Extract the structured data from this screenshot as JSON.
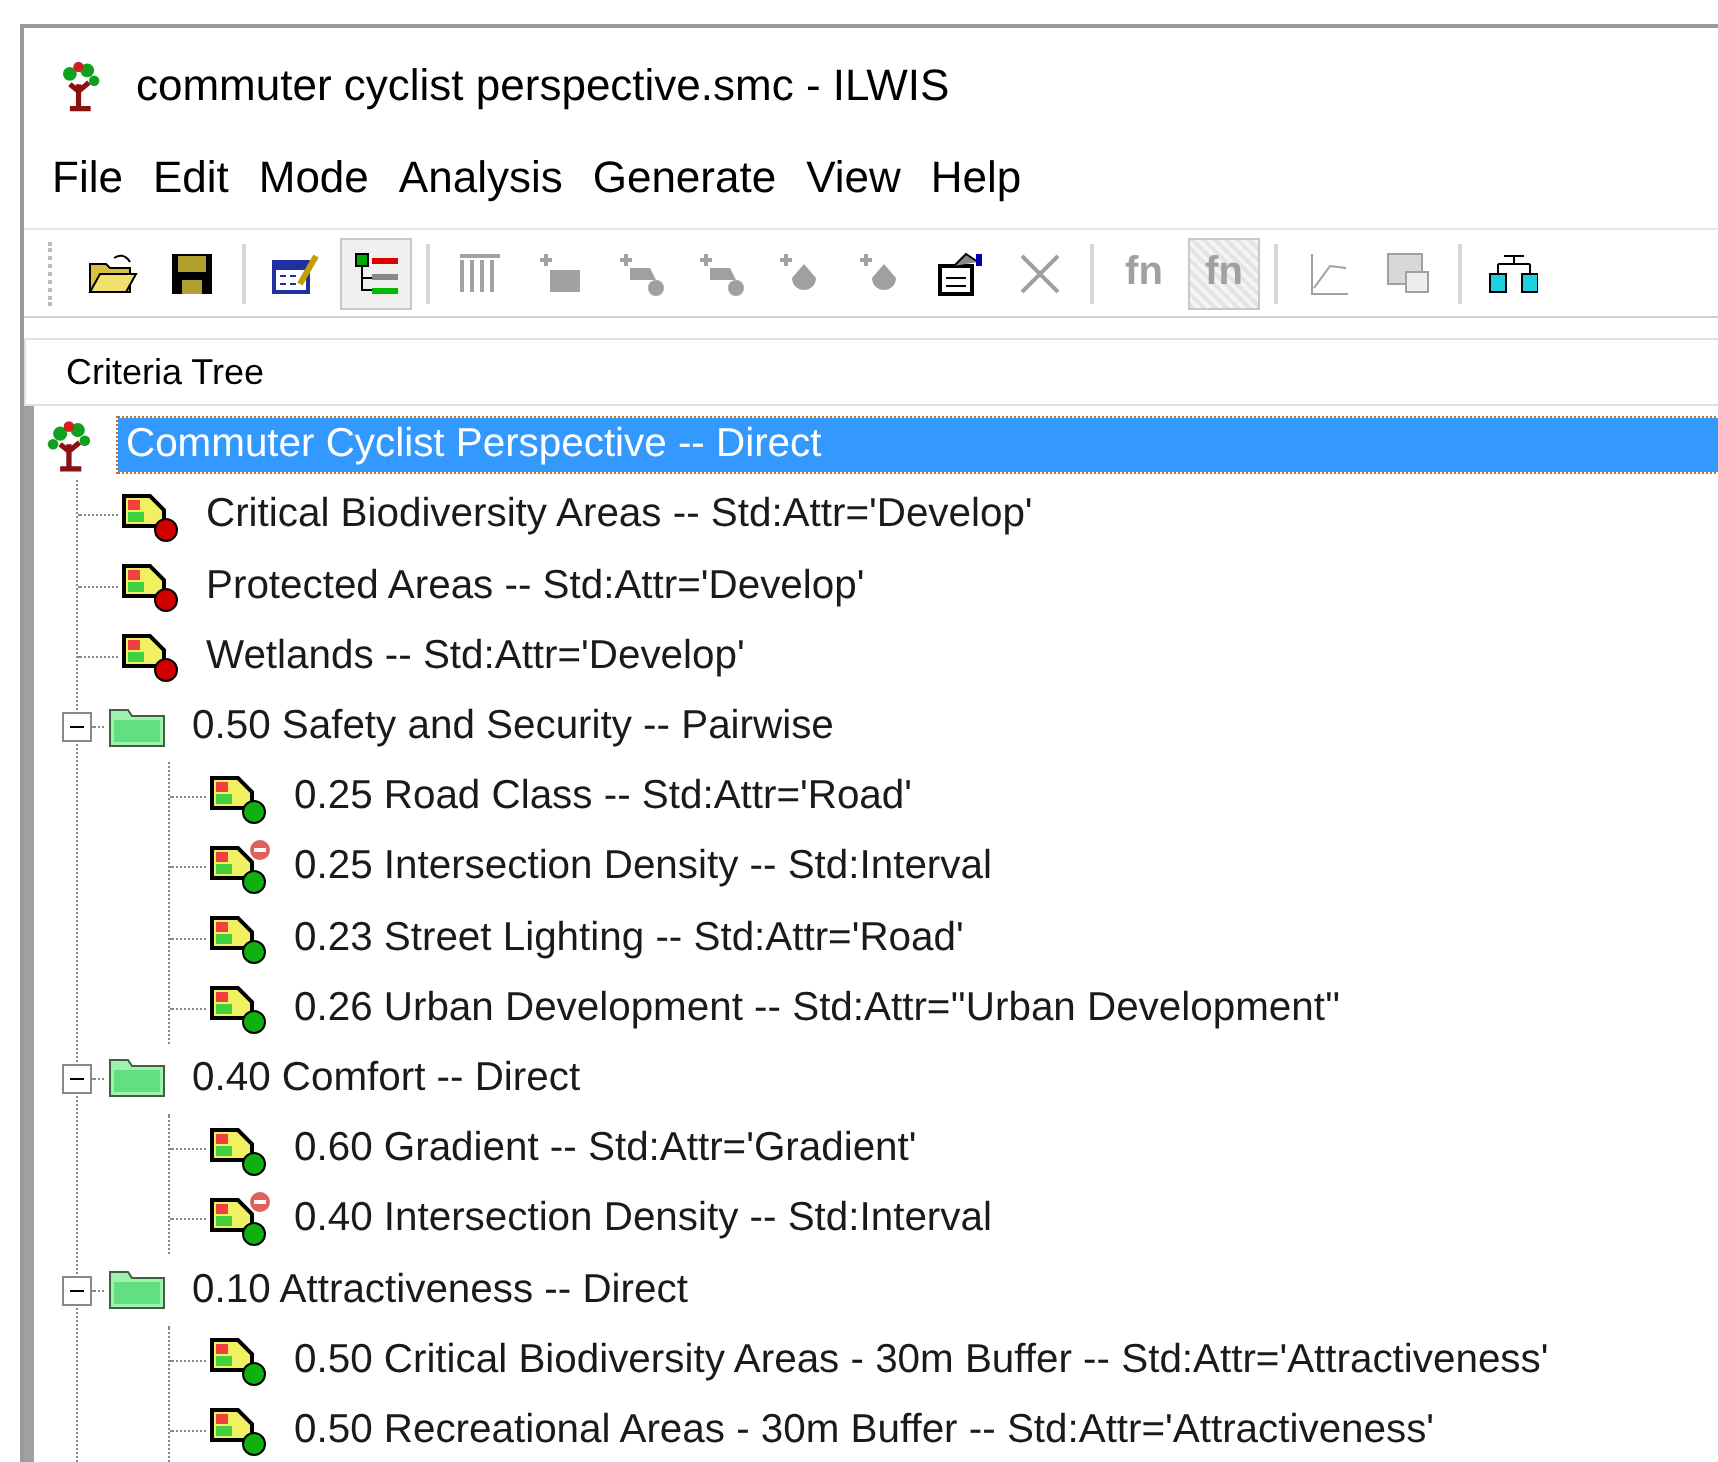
{
  "window": {
    "title": "commuter cyclist perspective.smc - ILWIS"
  },
  "menu": [
    {
      "label": "File"
    },
    {
      "label": "Edit"
    },
    {
      "label": "Mode"
    },
    {
      "label": "Analysis"
    },
    {
      "label": "Generate"
    },
    {
      "label": "View"
    },
    {
      "label": "Help"
    }
  ],
  "toolbar": [
    {
      "kind": "open",
      "disabled": false,
      "pressed": false
    },
    {
      "kind": "save",
      "disabled": false,
      "pressed": false
    },
    {
      "kind": "separator"
    },
    {
      "kind": "edit-table",
      "disabled": false,
      "pressed": false
    },
    {
      "kind": "tree",
      "disabled": false,
      "pressed": true
    },
    {
      "kind": "separator"
    },
    {
      "kind": "columns",
      "disabled": true,
      "pressed": false
    },
    {
      "kind": "add-map",
      "disabled": true,
      "pressed": false
    },
    {
      "kind": "add-factor",
      "disabled": true,
      "pressed": false
    },
    {
      "kind": "add-factor",
      "disabled": true,
      "pressed": false
    },
    {
      "kind": "add-point",
      "disabled": true,
      "pressed": false
    },
    {
      "kind": "add-point",
      "disabled": true,
      "pressed": false
    },
    {
      "kind": "properties",
      "disabled": false,
      "pressed": false
    },
    {
      "kind": "delete",
      "disabled": true,
      "pressed": false
    },
    {
      "kind": "separator"
    },
    {
      "kind": "function",
      "label": "fn",
      "disabled": true,
      "pressed": false
    },
    {
      "kind": "function-crossed",
      "label": "fn",
      "disabled": true,
      "pressed": true
    },
    {
      "kind": "separator"
    },
    {
      "kind": "graph",
      "disabled": true,
      "pressed": false
    },
    {
      "kind": "display",
      "disabled": true,
      "pressed": false
    },
    {
      "kind": "separator"
    },
    {
      "kind": "cluster",
      "disabled": false,
      "pressed": false
    }
  ],
  "panel": {
    "header": "Criteria Tree"
  },
  "tree": {
    "label": "Commuter Cyclist Perspective -- Direct",
    "kind": "root",
    "selected": true,
    "children": [
      {
        "label": "Critical Biodiversity Areas -- Std:Attr='Develop'",
        "kind": "constraint",
        "selected": false,
        "cost": false
      },
      {
        "label": "Protected Areas -- Std:Attr='Develop'",
        "kind": "constraint",
        "selected": false,
        "cost": false
      },
      {
        "label": "Wetlands -- Std:Attr='Develop'",
        "kind": "constraint",
        "selected": false,
        "cost": false
      },
      {
        "label": "0.50 Safety and Security -- Pairwise",
        "kind": "group",
        "selected": false,
        "expanded": true,
        "children": [
          {
            "label": "0.25 Road Class -- Std:Attr='Road'",
            "kind": "factor",
            "selected": false,
            "cost": false
          },
          {
            "label": "0.25 Intersection Density -- Std:Interval",
            "kind": "factor",
            "selected": false,
            "cost": true
          },
          {
            "label": "0.23 Street Lighting -- Std:Attr='Road'",
            "kind": "factor",
            "selected": false,
            "cost": false
          },
          {
            "label": "0.26 Urban Development -- Std:Attr=''Urban Development''",
            "kind": "factor",
            "selected": false,
            "cost": false
          }
        ]
      },
      {
        "label": "0.40 Comfort -- Direct",
        "kind": "group",
        "selected": false,
        "expanded": true,
        "children": [
          {
            "label": "0.60 Gradient -- Std:Attr='Gradient'",
            "kind": "factor",
            "selected": false,
            "cost": false
          },
          {
            "label": "0.40 Intersection Density -- Std:Interval",
            "kind": "factor",
            "selected": false,
            "cost": true
          }
        ]
      },
      {
        "label": "0.10 Attractiveness -- Direct",
        "kind": "group",
        "selected": false,
        "expanded": true,
        "children": [
          {
            "label": "0.50 Critical Biodiversity Areas - 30m Buffer -- Std:Attr='Attractiveness'",
            "kind": "factor",
            "selected": false,
            "cost": false
          },
          {
            "label": "0.50 Recreational Areas - 30m Buffer -- Std:Attr='Attractiveness'",
            "kind": "factor",
            "selected": false,
            "cost": false
          }
        ]
      }
    ]
  }
}
